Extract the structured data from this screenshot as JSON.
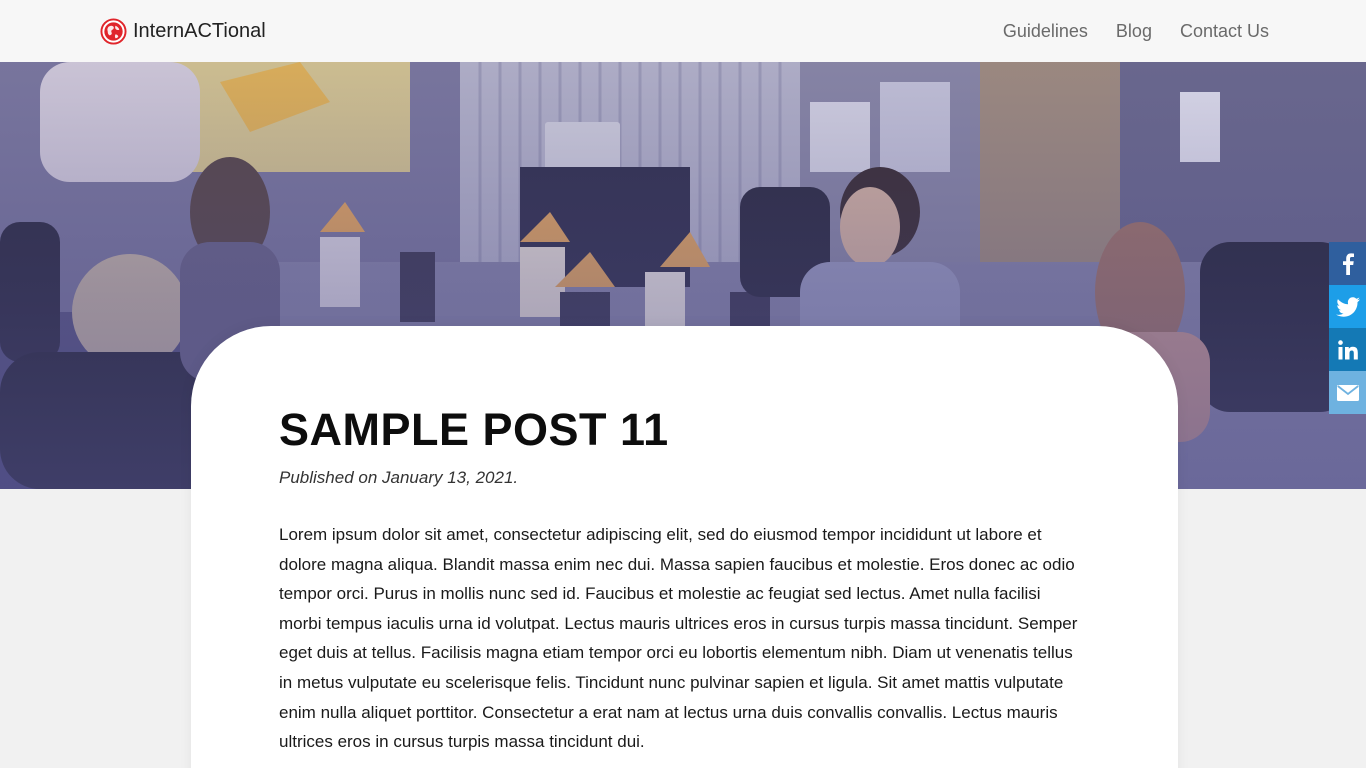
{
  "brand": {
    "name": "InternACTional",
    "logo_icon": "globe-icon",
    "accent": "#e0252b"
  },
  "nav": {
    "items": [
      {
        "label": "Guidelines"
      },
      {
        "label": "Blog"
      },
      {
        "label": "Contact Us"
      }
    ]
  },
  "hero": {
    "image": "meeting-room-photo"
  },
  "share": {
    "buttons": [
      {
        "icon": "facebook-icon",
        "color": "#2f5f9e"
      },
      {
        "icon": "twitter-icon",
        "color": "#1d9ee8"
      },
      {
        "icon": "linkedin-icon",
        "color": "#1479b5"
      },
      {
        "icon": "email-icon",
        "color": "#6eb2e0"
      }
    ]
  },
  "post": {
    "title": "SAMPLE POST 11",
    "published": "Published on January 13, 2021.",
    "body": "Lorem ipsum dolor sit amet, consectetur adipiscing elit, sed do eiusmod tempor incididunt ut labore et dolore magna aliqua. Blandit massa enim nec dui. Massa sapien faucibus et molestie. Eros donec ac odio tempor orci. Purus in mollis nunc sed id. Faucibus et molestie ac feugiat sed lectus. Amet nulla facilisi morbi tempus iaculis urna id volutpat. Lectus mauris ultrices eros in cursus turpis massa tincidunt. Semper eget duis at tellus. Facilisis magna etiam tempor orci eu lobortis elementum nibh. Diam ut venenatis tellus in metus vulputate eu scelerisque felis. Tincidunt nunc pulvinar sapien et ligula. Sit amet mattis vulputate enim nulla aliquet porttitor. Consectetur a erat nam at lectus urna duis convallis convallis. Lectus mauris ultrices eros in cursus turpis massa tincidunt dui."
  }
}
